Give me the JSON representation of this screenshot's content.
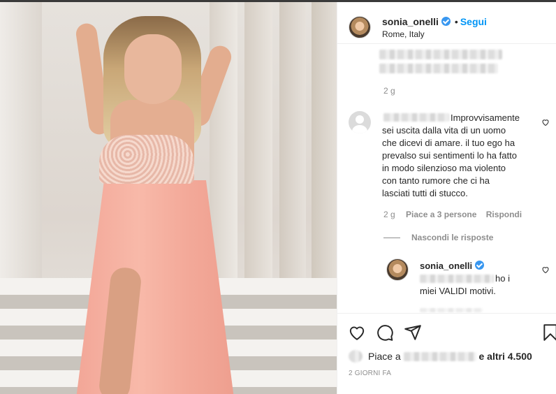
{
  "post": {
    "author": {
      "username": "sonia_onelli",
      "verified": true,
      "follow_label": "Segui",
      "separator": "•",
      "location": "Rome, Italy"
    },
    "caption": {
      "age": "2 g"
    },
    "comments": [
      {
        "text": "Improvvisamente sei uscita dalla vita di un uomo che dicevi di amare. il tuo ego ha prevalso sui sentimenti lo ha fatto in modo silenzioso ma violento con tanto rumore che ci ha lasciati tutti di stucco.",
        "lines": [
          "Improvvisamente",
          "sei uscita dalla vita di un uomo",
          "che dicevi di amare. il tuo ego ha",
          "prevalso sui sentimenti lo ha fatto",
          "in modo silenzioso ma violento",
          "con tanto rumore che ci ha",
          "lasciati tutti di stucco."
        ],
        "age": "2 g",
        "likes_label": "Piace a 3 persone",
        "reply_label": "Rispondi",
        "hide_replies_label": "Nascondi le risposte",
        "replies": [
          {
            "username": "sonia_onelli",
            "verified": true,
            "line1_tail": "ho i",
            "line2": "miei VALIDI motivi."
          }
        ]
      }
    ],
    "likes": {
      "prefix": "Piace a",
      "suffix": "e altri 4.500"
    },
    "timestamp": "2 GIORNI FA"
  },
  "colors": {
    "link_blue": "#0095f6",
    "verified_blue": "#3897f0",
    "secondary_text": "#8e8e8e",
    "primary_text": "#262626"
  },
  "icons": [
    "heart-icon",
    "comment-icon",
    "share-icon",
    "bookmark-icon",
    "verified-badge-icon",
    "small-heart-icon"
  ]
}
